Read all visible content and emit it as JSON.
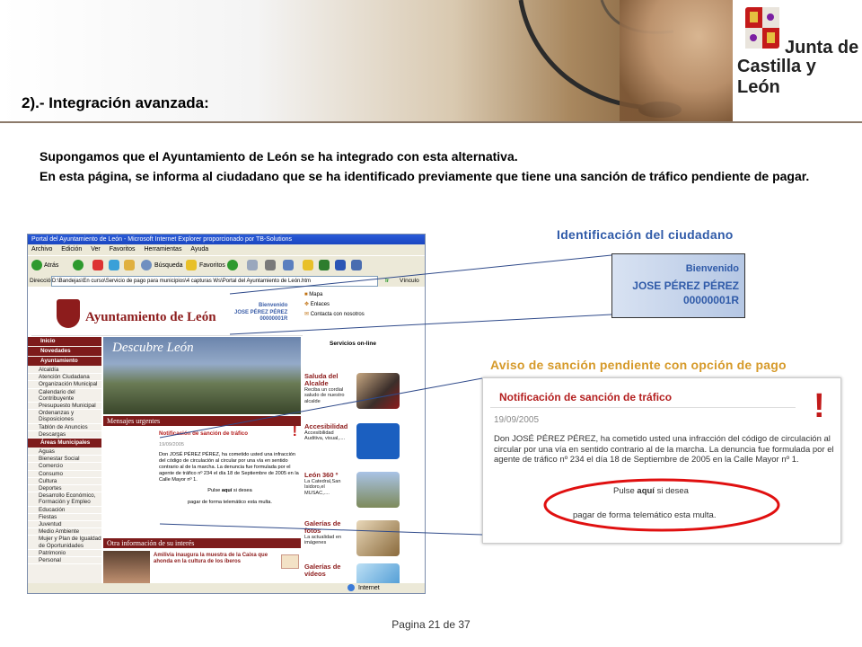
{
  "header": {
    "title": "2).- Integración avanzada:",
    "logo_line1": "Junta de",
    "logo_line2": "Castilla y León"
  },
  "intro": {
    "line1": "Supongamos que el Ayuntamiento de León se ha integrado con esta alternativa.",
    "line2": "En esta página, se  informa al ciudadano que se ha identificado previamente que tiene una sanción de tráfico pendiente de pagar."
  },
  "browser": {
    "title": "Portal del Ayuntamiento de León - Microsoft Internet Explorer proporcionado por TB-Solutions",
    "menu": [
      "Archivo",
      "Edición",
      "Ver",
      "Favoritos",
      "Herramientas",
      "Ayuda"
    ],
    "back": "Atrás",
    "search": "Búsqueda",
    "favorites": "Favoritos",
    "address_label": "Dirección",
    "address": "D:\\Bandejas\\En curso\\Servicio de pago para municipios\\4 capturas Ws\\Portal del Ayuntamiento de León.htm",
    "go": "Ir",
    "links": "Vínculo",
    "status": "Internet"
  },
  "site": {
    "name": "Ayuntamiento de León",
    "welcome": "Bienvenido",
    "user": "JOSE PÉREZ PÉREZ",
    "user_id": "00000001R",
    "rightnav": [
      "Mapa",
      "Enlaces",
      "Contacta con nosotros"
    ],
    "servicios": "Servicios on-line",
    "nav": [
      {
        "type": "head",
        "label": "Inicio"
      },
      {
        "type": "head",
        "label": "Novedades"
      },
      {
        "type": "head",
        "label": "Ayuntamiento"
      },
      {
        "type": "item",
        "label": "Alcaldía"
      },
      {
        "type": "item",
        "label": "Atención Ciudadana"
      },
      {
        "type": "item",
        "label": "Organización Municipal"
      },
      {
        "type": "item",
        "label": "Calendario del Contribuyente"
      },
      {
        "type": "item",
        "label": "Presupuesto Municipal"
      },
      {
        "type": "item",
        "label": "Ordenanzas y Disposiciones"
      },
      {
        "type": "item",
        "label": "Tablón de Anuncios"
      },
      {
        "type": "item",
        "label": "Descargas"
      },
      {
        "type": "head",
        "label": "Áreas Municipales"
      },
      {
        "type": "item",
        "label": "Aguas"
      },
      {
        "type": "item",
        "label": "Bienestar Social"
      },
      {
        "type": "item",
        "label": "Comercio"
      },
      {
        "type": "item",
        "label": "Consumo"
      },
      {
        "type": "item",
        "label": "Cultura"
      },
      {
        "type": "item",
        "label": "Deportes"
      },
      {
        "type": "item",
        "label": "Desarrollo Económico, Formación y Empleo"
      },
      {
        "type": "item",
        "label": "Educación"
      },
      {
        "type": "item",
        "label": "Fiestas"
      },
      {
        "type": "item",
        "label": "Juventud"
      },
      {
        "type": "item",
        "label": "Medio Ambiente"
      },
      {
        "type": "item",
        "label": "Mujer y Plan de Igualdad de Oportunidades"
      },
      {
        "type": "item",
        "label": "Patrimonio"
      },
      {
        "type": "item",
        "label": "Personal"
      }
    ],
    "photo_caption": "Descubre León",
    "urgentes": "Mensajes urgentes",
    "notif_title": "Notificación de sanción de tráfico",
    "notif_date": "19/09/2005",
    "notif_body": "Don JOSÉ PÉREZ PÉREZ, ha cometido usted una infracción del código de circulación al circular por una vía en sentido contrario al de la marcha. La denuncia fue formulada por el agente de tráfico nº 234 el día 18 de Septiembre de 2005 en la Calle Mayor nº 1.",
    "notif_pulse_pre": "Pulse ",
    "notif_pulse_link": "aquí",
    "notif_pulse_post": " si desea",
    "notif_pagar": "pagar de forma telemático esta multa.",
    "otra": "Otra información de su interés",
    "otra_item": "Amilivia inaugura la muestra de la Caixa que ahonda en la cultura de los íberos",
    "services": [
      {
        "title": "Saluda del Alcalde",
        "desc": "Reciba un cordial saludo de nuestro alcalde"
      },
      {
        "title": "Accesibilidad",
        "desc": "Accesibilidad Auditiva, visual,...."
      },
      {
        "title": "León 360 º",
        "desc": "La Catedral,San Isidoro,el MUSAC,...."
      },
      {
        "title": "Galerías de fotos",
        "desc": "La actualidad en imágenes"
      },
      {
        "title": "Galerías de vídeos",
        "desc": ""
      }
    ]
  },
  "callouts": {
    "id_label": "Identificación  del ciudadano",
    "id_welcome": "Bienvenido",
    "id_name": "JOSE PÉREZ PÉREZ",
    "id_number": "00000001R",
    "aviso_label": "Aviso de sanción pendiente con opción de pago",
    "aviso_title": "Notificación de sanción de tráfico",
    "aviso_date": "19/09/2005",
    "aviso_body": "Don JOSÉ PÉREZ PÉREZ, ha cometido usted una infracción del código de circulación al circular por una vía en sentido contrario al de la marcha. La denuncia fue formulada por el agente de tráfico nº 234 el día 18 de Septiembre de 2005 en la Calle Mayor nº 1.",
    "aviso_pulse_pre": "Pulse ",
    "aviso_pulse_link": "aquí",
    "aviso_pulse_post": " si desea",
    "aviso_pagar": "pagar de forma telemático esta multa.",
    "exclamation": "!"
  },
  "footer": {
    "page": "Pagina 21 de 37"
  },
  "colors": {
    "brand_red": "#7d1b1b",
    "callout_blue": "#2f5aa8",
    "callout_orange": "#d69a2a"
  }
}
